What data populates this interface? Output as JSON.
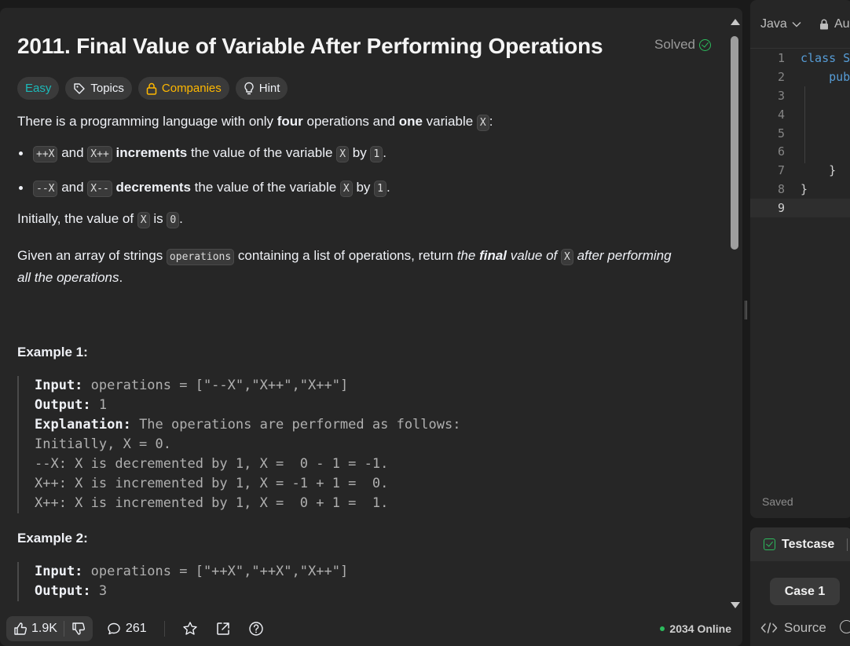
{
  "problem": {
    "title": "2011. Final Value of Variable After Performing Operations",
    "status": "Solved",
    "tags": {
      "difficulty": "Easy",
      "topics": "Topics",
      "companies": "Companies",
      "hint": "Hint"
    },
    "intro": {
      "t1": "There is a programming language with only ",
      "b1": "four",
      "t2": " operations and ",
      "b2": "one",
      "t3": " variable ",
      "c1": "X",
      "t4": ":"
    },
    "bullet1": {
      "c1": "++X",
      "t1": " and ",
      "c2": "X++",
      "b1": "increments",
      "t2": " the value of the variable ",
      "c3": "X",
      "t3": " by ",
      "c4": "1",
      "t4": "."
    },
    "bullet2": {
      "c1": "--X",
      "t1": " and ",
      "c2": "X--",
      "b1": "decrements",
      "t2": " the value of the variable ",
      "c3": "X",
      "t3": " by ",
      "c4": "1",
      "t4": "."
    },
    "initial": {
      "t1": "Initially, the value of ",
      "c1": "X",
      "t2": " is ",
      "c2": "0",
      "t3": "."
    },
    "given": {
      "t1": "Given an array of strings ",
      "c1": "operations",
      "t2": " containing a list of operations, return ",
      "i1": "the ",
      "bi": "final",
      "i2": " value of ",
      "c2": "X",
      "i3": " after performing all the operations",
      "t3": "."
    },
    "example1": {
      "title": "Example 1:",
      "input_label": "Input:",
      "input_value": " operations = [\"--X\",\"X++\",\"X++\"]",
      "output_label": "Output:",
      "output_value": " 1",
      "explanation_label": "Explanation:",
      "explanation_value": " The operations are performed as follows:",
      "lines": [
        "Initially, X = 0.",
        "--X: X is decremented by 1, X =  0 - 1 = -1.",
        "X++: X is incremented by 1, X = -1 + 1 =  0.",
        "X++: X is incremented by 1, X =  0 + 1 =  1."
      ]
    },
    "example2": {
      "title": "Example 2:",
      "input_label": "Input:",
      "input_value": " operations = [\"++X\",\"++X\",\"X++\"]",
      "output_label": "Output:",
      "output_value": " 3"
    }
  },
  "footer": {
    "likes": "1.9K",
    "comments": "261",
    "online": "2034 Online"
  },
  "editor": {
    "language": "Java",
    "mode": "Au",
    "lines": [
      {
        "num": "1",
        "kw": "class S",
        "rest": ""
      },
      {
        "num": "2",
        "kw": "    pub",
        "rest": ""
      },
      {
        "num": "3",
        "kw": "",
        "rest": ""
      },
      {
        "num": "4",
        "kw": "",
        "rest": ""
      },
      {
        "num": "5",
        "kw": "",
        "rest": ""
      },
      {
        "num": "6",
        "kw": "",
        "rest": ""
      },
      {
        "num": "7",
        "kw": "",
        "rest": "    }"
      },
      {
        "num": "8",
        "kw": "",
        "rest": "}"
      },
      {
        "num": "9",
        "kw": "",
        "rest": ""
      }
    ],
    "status": "Saved"
  },
  "testcase": {
    "tab": "Testcase",
    "case": "Case 1",
    "source": "Source"
  },
  "colors": {
    "easy": "#1cbaba",
    "companies": "#ffb800",
    "solved": "#2cbb5d",
    "keyword": "#569cd6"
  }
}
